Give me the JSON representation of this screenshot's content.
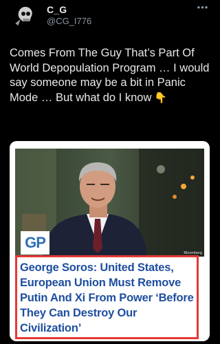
{
  "user": {
    "display_name": "C_G",
    "handle": "@CG_I776",
    "avatar_icon": "skull-avatar-icon"
  },
  "menu": {
    "more_label": "•••"
  },
  "tweet": {
    "text": "Comes From The Guy That’s Part Of World Depopulation Program … I would say someone may be a bit in Panic Mode … But what do I know",
    "emoji": "👇"
  },
  "card": {
    "logo_text": "GP",
    "photo_credit": "Bloomberg",
    "headline": "George Soros: United States, European Union Must Remove Putin And Xi From Power ‘Before They Can Destroy Our Civilization’",
    "colors": {
      "headline": "#1d4e9e",
      "border": "#e53935",
      "logo": "#2d6fb7"
    }
  }
}
